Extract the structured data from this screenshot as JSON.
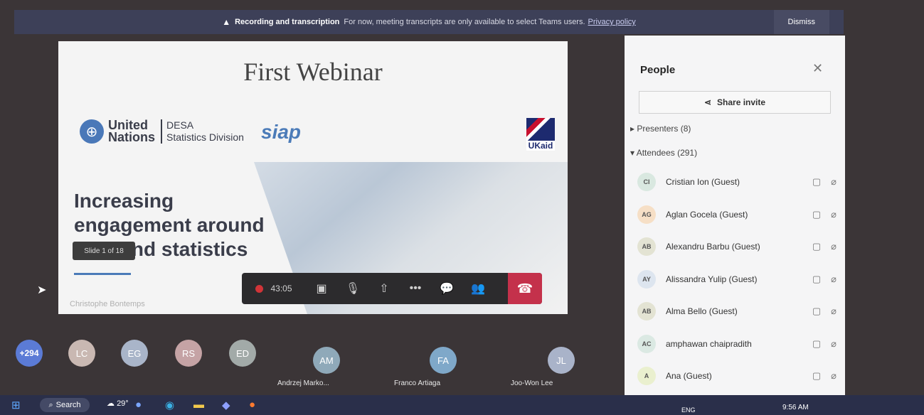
{
  "banner": {
    "title": "Recording and transcription",
    "message": "For now, meeting transcripts are only available to select Teams users.",
    "link": "Privacy policy",
    "dismiss": "Dismiss"
  },
  "slide": {
    "title": "First Webinar",
    "un_name_1": "United",
    "un_name_2": "Nations",
    "desa": "DESA",
    "desa_sub": "Statistics Division",
    "siap": "siap",
    "ukaid": "UKaid",
    "headline": "Increasing engagement around data and statistics",
    "counter": "Slide 1 of 18",
    "author": "Christophe Bontemps"
  },
  "controls": {
    "timer": "43:05"
  },
  "people": {
    "title": "People",
    "share_invite": "Share invite",
    "presenters": "Presenters (8)",
    "attendees": "Attendees (291)",
    "list": [
      {
        "initials": "CI",
        "name": "Cristian Ion (Guest)",
        "color": "#d9e8e0"
      },
      {
        "initials": "AG",
        "name": "Aglan Gocela (Guest)",
        "color": "#f6dfc6"
      },
      {
        "initials": "AB",
        "name": "Alexandru Barbu (Guest)",
        "color": "#e3e3d3"
      },
      {
        "initials": "AY",
        "name": "Alissandra Yulip (Guest)",
        "color": "#dde5ef"
      },
      {
        "initials": "AB",
        "name": "Alma Bello (Guest)",
        "color": "#e3e3d3"
      },
      {
        "initials": "AC",
        "name": "amphawan chaipradith",
        "color": "#dbe9e3"
      },
      {
        "initials": "A",
        "name": "Ana (Guest)",
        "color": "#eaf0cf"
      }
    ]
  },
  "gallery": {
    "overflow": "+294",
    "avatars": [
      {
        "initials": "LC",
        "color": "#c9b8b2"
      },
      {
        "initials": "EG",
        "color": "#a9b5c9"
      },
      {
        "initials": "RS",
        "color": "#c5a3a5"
      },
      {
        "initials": "ED",
        "color": "#a2aaa8"
      }
    ],
    "tiles": [
      {
        "initials": "AM",
        "name": "Andrzej Marko...",
        "color": "#8fa9b9"
      },
      {
        "initials": "FA",
        "name": "Franco Artiaga",
        "color": "#7fa8c9"
      },
      {
        "initials": "JL",
        "name": "Joo-Won Lee",
        "color": "#a9b3c9"
      }
    ]
  },
  "taskbar": {
    "search": "Search",
    "weather": "29°",
    "lang": "ENG",
    "time": "9:56 AM"
  }
}
